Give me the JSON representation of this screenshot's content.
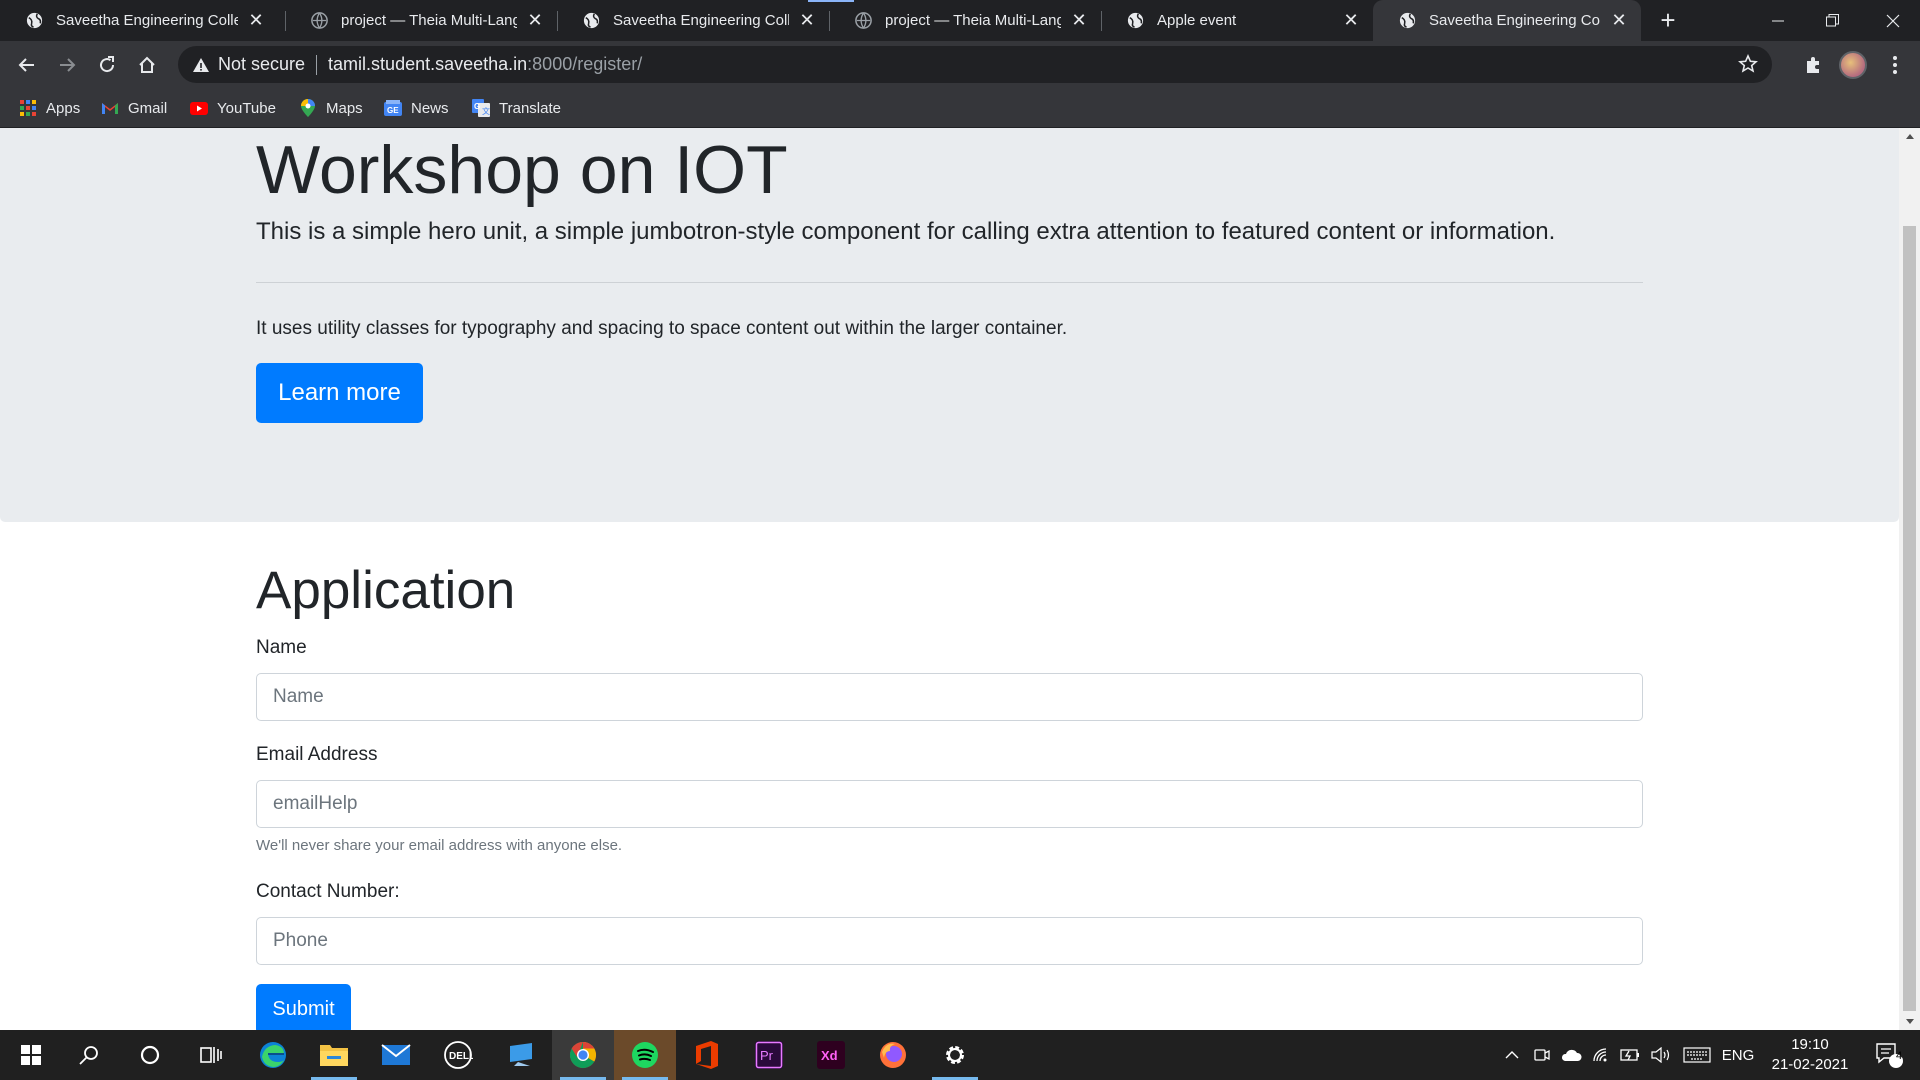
{
  "browser": {
    "tabs": [
      {
        "title": "Saveetha Engineering College",
        "icon": "globe-icon"
      },
      {
        "title": "project — Theia Multi-Language",
        "icon": "theia-icon"
      },
      {
        "title": "Saveetha Engineering College",
        "icon": "globe-icon"
      },
      {
        "title": "project — Theia Multi-Language",
        "icon": "theia-icon"
      },
      {
        "title": "Apple event",
        "icon": "globe-icon"
      },
      {
        "title": "Saveetha Engineering College",
        "icon": "globe-icon",
        "active": true
      }
    ],
    "address": {
      "security_label": "Not secure",
      "host": "tamil.student.saveetha.in",
      "path": ":8000/register/"
    },
    "bookmarks": [
      {
        "label": "Apps",
        "icon": "apps-grid-icon"
      },
      {
        "label": "Gmail",
        "icon": "gmail-icon"
      },
      {
        "label": "YouTube",
        "icon": "youtube-icon"
      },
      {
        "label": "Maps",
        "icon": "maps-icon"
      },
      {
        "label": "News",
        "icon": "news-icon"
      },
      {
        "label": "Translate",
        "icon": "translate-icon"
      }
    ]
  },
  "page": {
    "hero": {
      "title": "Workshop on IOT",
      "lead": "This is a simple hero unit, a simple jumbotron-style component for calling extra attention to featured content or information.",
      "paragraph": "It uses utility classes for typography and spacing to space content out within the larger container.",
      "button_label": "Learn more"
    },
    "form": {
      "heading": "Application",
      "name_label": "Name",
      "name_placeholder": "Name",
      "email_label": "Email Address",
      "email_placeholder": "emailHelp",
      "email_help": "We'll never share your email address with anyone else.",
      "phone_label": "Contact Number:",
      "phone_placeholder": "Phone",
      "submit_label": "Submit"
    }
  },
  "taskbar": {
    "apps": [
      "start-icon",
      "search-icon",
      "cortana-icon",
      "task-view-icon",
      "edge-icon",
      "file-explorer-icon",
      "mail-icon",
      "dell-icon",
      "remote-desktop-icon",
      "chrome-icon",
      "spotify-icon",
      "office-icon",
      "premiere-icon",
      "xd-icon",
      "firefox-icon",
      "settings-icon"
    ],
    "tray": {
      "language": "ENG",
      "time": "19:10",
      "date": "21-02-2021",
      "notification_count": "4"
    }
  },
  "colors": {
    "primary": "#007bff",
    "jumbotron_bg": "#e9ecef",
    "chrome_dark": "#202124",
    "chrome_toolbar": "#35363a"
  }
}
